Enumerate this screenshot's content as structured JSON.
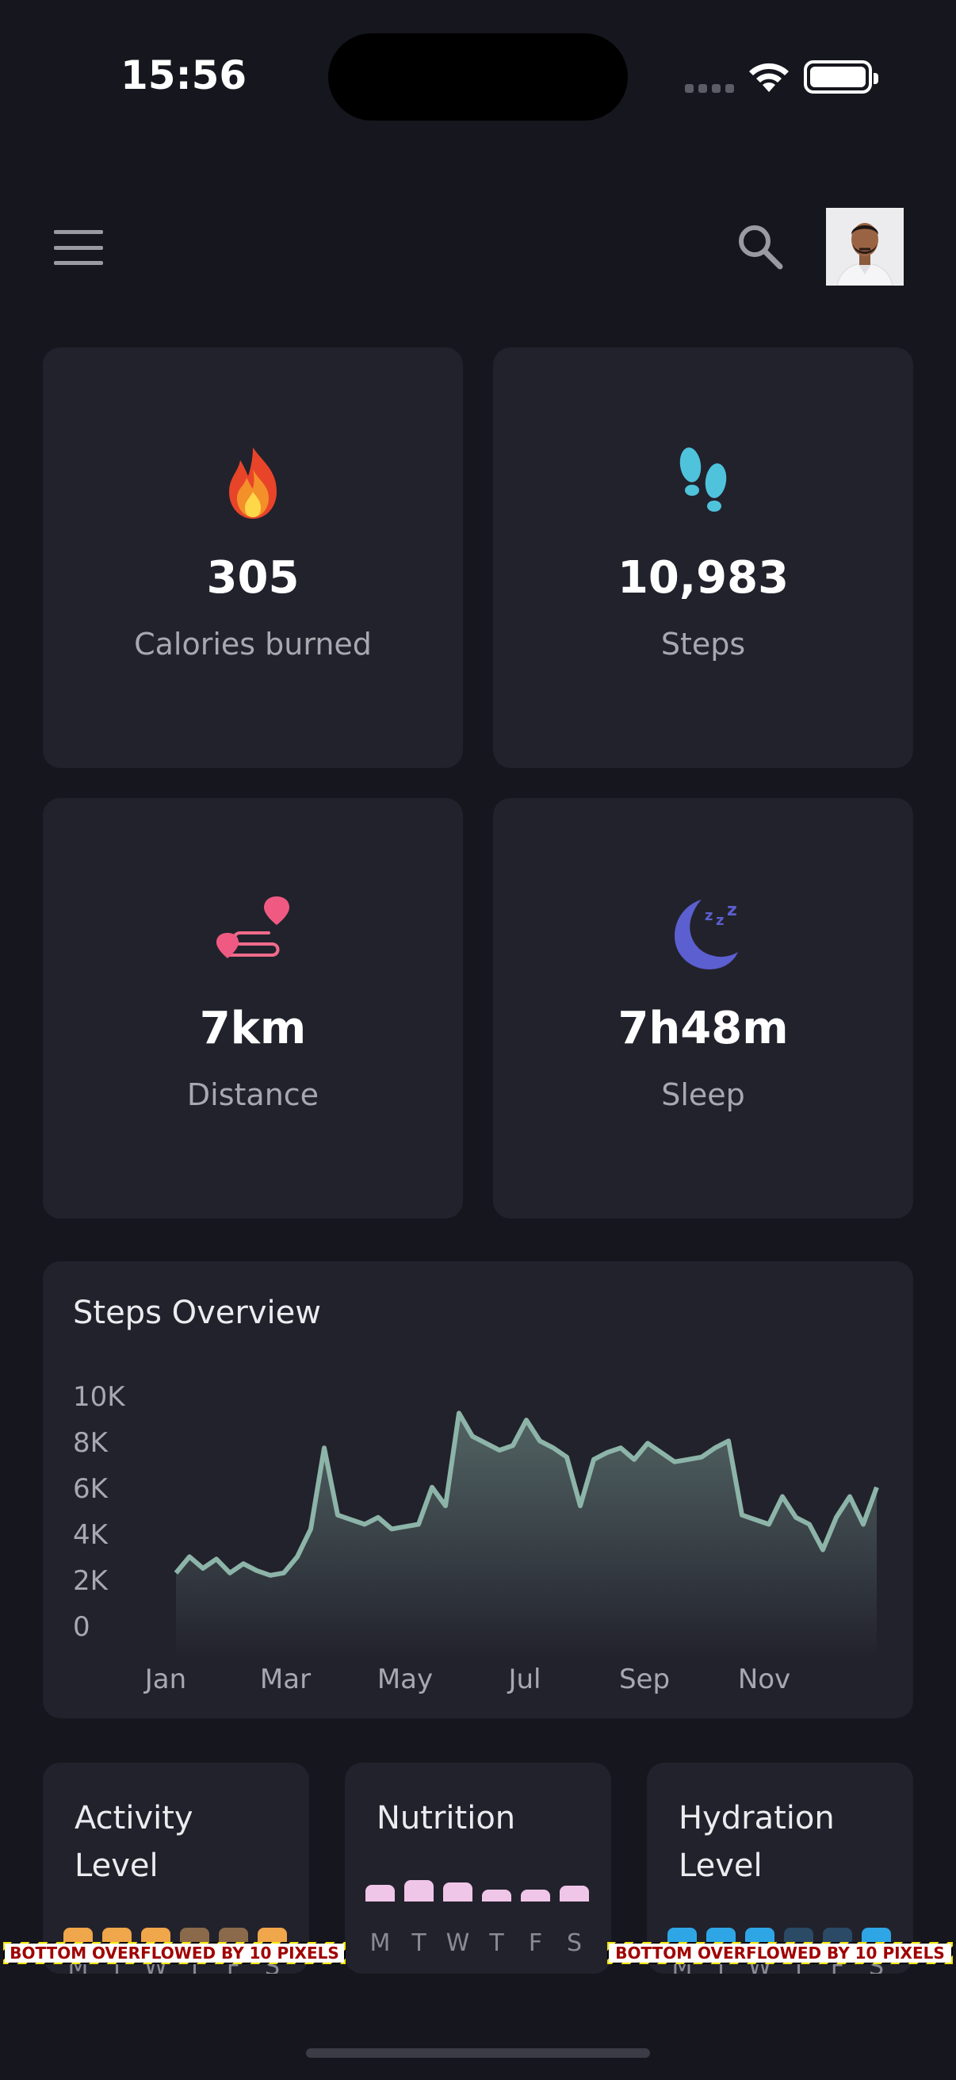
{
  "status": {
    "time": "15:56"
  },
  "stats": [
    {
      "value": "305",
      "label": "Calories burned",
      "icon": "fire-icon"
    },
    {
      "value": "10,983",
      "label": "Steps",
      "icon": "footsteps-icon"
    },
    {
      "value": "7km",
      "label": "Distance",
      "icon": "route-icon"
    },
    {
      "value": "7h48m",
      "label": "Sleep",
      "icon": "moon-sleep-icon"
    }
  ],
  "overview": {
    "title": "Steps Overview"
  },
  "chart_data": {
    "type": "area",
    "title": "Steps Overview",
    "x_tick_labels": [
      "Jan",
      "Mar",
      "May",
      "Jul",
      "Sep",
      "Nov"
    ],
    "y_tick_labels": [
      "10K",
      "8K",
      "6K",
      "4K",
      "2K",
      "0"
    ],
    "ylim": [
      0,
      10000
    ],
    "xlim": [
      0,
      52
    ],
    "x": [
      0,
      1,
      2,
      3,
      4,
      5,
      6,
      7,
      8,
      9,
      10,
      11,
      12,
      13,
      14,
      15,
      16,
      17,
      18,
      19,
      20,
      21,
      22,
      23,
      24,
      25,
      26,
      27,
      28,
      29,
      30,
      31,
      32,
      33,
      34,
      35,
      36,
      37,
      38,
      39,
      40,
      41,
      42,
      43,
      44,
      45,
      46,
      47,
      48,
      49,
      50,
      51,
      52
    ],
    "values": [
      2300,
      3000,
      2500,
      2900,
      2300,
      2700,
      2400,
      2200,
      2300,
      3000,
      4200,
      7700,
      4800,
      4600,
      4400,
      4700,
      4200,
      4300,
      4400,
      6000,
      5200,
      9200,
      8200,
      7900,
      7600,
      7800,
      8900,
      8000,
      7700,
      7300,
      5200,
      7200,
      7500,
      7700,
      7200,
      7900,
      7500,
      7100,
      7200,
      7300,
      7700,
      8000,
      4800,
      4600,
      4400,
      5600,
      4700,
      4400,
      3300,
      4700,
      5600,
      4400,
      6000
    ],
    "series_color": "#8db4a8",
    "grid": false
  },
  "mini_cards": [
    {
      "title": "Activity Level",
      "days": [
        "M",
        "T",
        "W",
        "T",
        "F",
        "S"
      ],
      "levels": [
        0.9,
        0.9,
        0.9,
        0.9,
        0.9,
        0.9
      ],
      "colors": [
        "#f0a64a",
        "#f0a64a",
        "#f0a64a",
        "#8a6a4a",
        "#8a6a4a",
        "#f0a64a"
      ]
    },
    {
      "title": "Nutrition",
      "days": [
        "M",
        "T",
        "W",
        "T",
        "F",
        "S"
      ],
      "levels": [
        0.7,
        0.9,
        0.8,
        0.5,
        0.5,
        0.65
      ],
      "colors": [
        "#f0c6e8",
        "#f0c6e8",
        "#f0c6e8",
        "#f0c6e8",
        "#f0c6e8",
        "#f0c6e8"
      ]
    },
    {
      "title": "Hydration Level",
      "days": [
        "M",
        "T",
        "W",
        "T",
        "F",
        "S"
      ],
      "levels": [
        0.9,
        0.9,
        0.9,
        0.9,
        0.9,
        0.9
      ],
      "colors": [
        "#2ea6e6",
        "#2ea6e6",
        "#2ea6e6",
        "#2a4a66",
        "#2a4a66",
        "#2ea6e6"
      ]
    }
  ],
  "overflow": {
    "message": "BOTTOM OVERFLOWED BY 10 PIXELS"
  }
}
